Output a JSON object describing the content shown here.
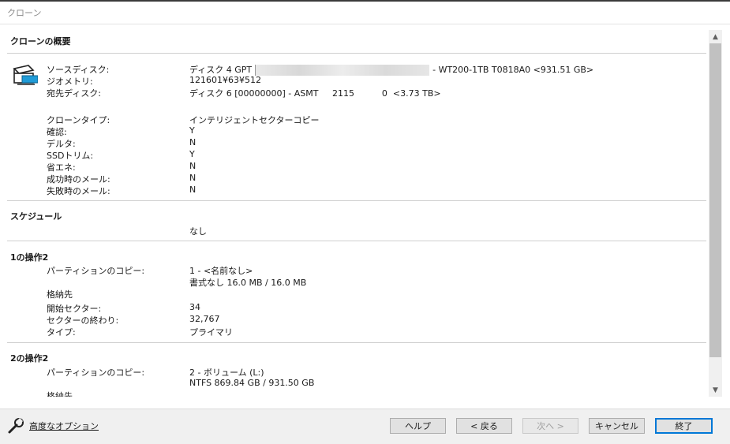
{
  "window": {
    "title": "クローン"
  },
  "summary": {
    "heading": "クローンの概要",
    "rows": [
      {
        "label": "ソースディスク:",
        "value_prefix": "ディスク 4 GPT",
        "value_suffix": "- WT200-1TB T0818A0  <931.51 GB>"
      },
      {
        "label": "ジオメトリ:",
        "value": "121601¥63¥512"
      },
      {
        "label": "宛先ディスク:",
        "value": "ディスク 6 [00000000] - ASMT     2115          0  <3.73 TB>"
      }
    ],
    "options": [
      {
        "label": "クローンタイプ:",
        "value": "インテリジェントセクターコピー"
      },
      {
        "label": "確認:",
        "value": "Y"
      },
      {
        "label": "デルタ:",
        "value": "N"
      },
      {
        "label": "SSDトリム:",
        "value": "Y"
      },
      {
        "label": "省エネ:",
        "value": "N"
      },
      {
        "label": "成功時のメール:",
        "value": "N"
      },
      {
        "label": "失敗時のメール:",
        "value": "N"
      }
    ]
  },
  "schedule": {
    "heading": "スケジュール",
    "value": "なし"
  },
  "op1": {
    "heading": "1の操作2",
    "copy_label": "パーティションのコピー:",
    "copy_value": "1 - <名前なし>",
    "copy_detail": "書式なし 16.0 MB / 16.0 MB",
    "storage_label": "格納先",
    "start_label": "開始セクター:",
    "start_value": "34",
    "end_label": "セクターの終わり:",
    "end_value": "32,767",
    "type_label": "タイプ:",
    "type_value": "プライマリ"
  },
  "op2": {
    "heading": "2の操作2",
    "copy_label": "パーティションのコピー:",
    "copy_value": "2 - ボリューム (L:)",
    "copy_detail": "NTFS 869.84 GB / 931.50 GB",
    "storage_label": "格納先"
  },
  "footer": {
    "advanced_label": "高度なオプション",
    "buttons": {
      "help": "ヘルプ",
      "back": "< 戻る",
      "next": "次へ >",
      "cancel": "キャンセル",
      "finish": "終了"
    }
  },
  "colors": {
    "accent": "#0078d7",
    "scroll_thumb": "#c1c1c1",
    "footer_bg": "#f0f0f0"
  },
  "icons": {
    "disk": "disk-clone-icon",
    "wrench": "wrench-icon",
    "scroll_up": "chevron-up-icon",
    "scroll_down": "chevron-down-icon"
  }
}
